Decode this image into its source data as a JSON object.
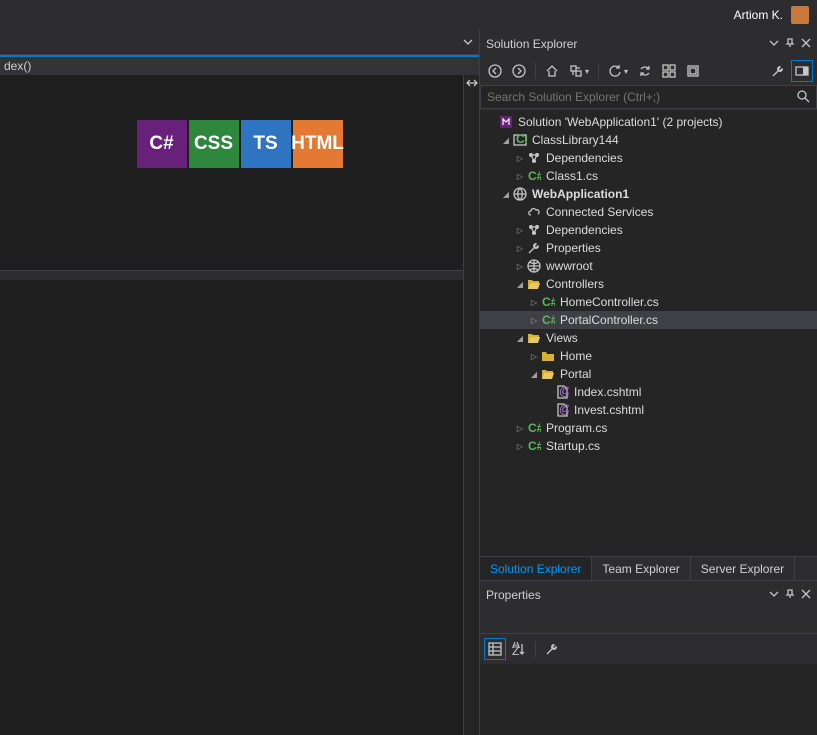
{
  "topbar": {
    "user": "Artiom K."
  },
  "editor": {
    "breadcrumb": "dex()"
  },
  "tiles": {
    "csharp": "C#",
    "css": "CSS",
    "ts": "TS",
    "html": "HTML"
  },
  "solution_explorer": {
    "title": "Solution Explorer",
    "search_placeholder": "Search Solution Explorer (Ctrl+;)",
    "tree": {
      "solution": "Solution 'WebApplication1' (2 projects)",
      "lib": "ClassLibrary144",
      "lib_deps": "Dependencies",
      "lib_class1": "Class1.cs",
      "app": "WebApplication1",
      "app_connected": "Connected Services",
      "app_deps": "Dependencies",
      "app_props": "Properties",
      "app_www": "wwwroot",
      "app_ctrl": "Controllers",
      "ctrl_home": "HomeController.cs",
      "ctrl_portal": "PortalController.cs",
      "app_views": "Views",
      "views_home": "Home",
      "views_portal": "Portal",
      "view_index": "Index.cshtml",
      "view_invest": "Invest.cshtml",
      "app_program": "Program.cs",
      "app_startup": "Startup.cs"
    }
  },
  "bottom_tabs": {
    "se": "Solution Explorer",
    "te": "Team Explorer",
    "srv": "Server Explorer"
  },
  "properties": {
    "title": "Properties"
  }
}
